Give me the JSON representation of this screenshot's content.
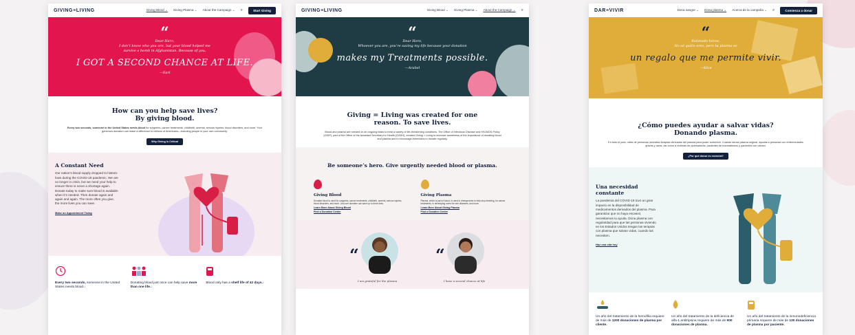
{
  "colors": {
    "navy": "#14213d",
    "crimson": "#e3154f",
    "teal": "#1f3b44",
    "gold": "#e0ad3a",
    "pink_bg": "#f7edf0"
  },
  "panel1": {
    "logo": "GIVING≡LIVING",
    "nav": {
      "link1": "Giving Blood ⌄",
      "link2": "Giving Plasma ⌄",
      "link3": "About the Campaign ⌄",
      "search_icon": "search-icon",
      "cta": "Start Giving"
    },
    "hero": {
      "quote_mark": "“",
      "line1": "Dear Hero,",
      "line2": "I don’t know who you are, but your blood helped me",
      "line3": "survive a bomb in Afghanistan. Because of you,",
      "big": "I GOT A SECOND CHANCE AT LIFE.",
      "sig": "—Earl"
    },
    "help": {
      "title1": "How can you help save lives?",
      "title2": "By giving blood.",
      "body_bold": "Every two seconds, someone in the United States needs blood",
      "body": " for surgeries, cancer treatments, childbirth, anemia, serious injuries, blood disorders, and more. Your generous donation can make a difference to millions of Americans—including people in your own community.",
      "button": "Why Giving is Critical"
    },
    "need": {
      "title": "A Constant Need",
      "body": "Our nation’s blood supply dropped to historic lows during the COVID-19 pandemic. We are no longer in crisis, but we need your help to ensure there is never a shortage again. Donate today to make sure blood is available when it’s needed. Then donate again and again and again. The more often you give, the more lives you can save.",
      "link": "Make an Appointment Today"
    },
    "stats": [
      {
        "icon": "clock-icon",
        "bold": "Every two seconds,",
        "text": " someone in the United States needs blood.↓"
      },
      {
        "icon": "people-icon",
        "text": "Donating blood just once can help save ",
        "bold": "more than one life.",
        "tail": "↓"
      },
      {
        "icon": "blood-bag-icon",
        "text": "Blood only has a ",
        "bold": "shelf life of 42 days.",
        "tail": "↓"
      }
    ]
  },
  "panel2": {
    "logo": "GIVING≡LIVING",
    "nav": {
      "link1": "Giving Blood ⌄",
      "link2": "Giving Plasma ⌄",
      "link3": "About the Campaign ⌄",
      "search_icon": "search-icon"
    },
    "hero": {
      "quote_mark": "“",
      "line1": "Dear Hero,",
      "line2": "Whoever you are, you’re saving my life because your donation",
      "big": "makes my Treatments possible.",
      "sig": "—Arabel"
    },
    "about": {
      "title1": "Giving = Living was created for one",
      "title2": "reason. To save lives.",
      "body": "Blood and plasma are needed on an ongoing basis to treat a variety of life-threatening conditions. The Office of Infectious Disease and HIV/AIDS Policy (OIDP), part of the Office of the Assistant Secretary for Health (OASH), created Giving = Living to increase awareness of the importance of donating blood and plasma and to encourage Americans to donate regularly."
    },
    "hero_sec": {
      "title": "Be someone’s hero. Give urgently needed blood or plasma."
    },
    "blood": {
      "title": "Giving Blood",
      "body": "Donated blood is used for surgeries, cancer treatments, childbirth, anemia, serious injuries, blood disorders, and more. Just one donation can save up to three lives.",
      "link1": "Learn More About Giving Blood",
      "link2": "Find a Donation Center"
    },
    "plasma": {
      "title": "Giving Plasma",
      "body": "Plasma, which is part of blood, is used in emergencies to help stop bleeding, for cancer treatments, in developing cures for rare diseases, and more.",
      "link1": "Learn More About Giving Plasma",
      "link2": "Find a Donation Center"
    },
    "testimonials": {
      "q1": "I am grateful for the plasma",
      "q2": "I have a second chance at life"
    }
  },
  "panel3": {
    "logo": "DAR≡VIVIR",
    "nav": {
      "link1": "Dona sangre ⌄",
      "link2": "Dona plasma ⌄",
      "link3": "Acerca de la campaña ⌄",
      "search_icon": "search-icon",
      "cta": "Comienza a donar"
    },
    "hero": {
      "quote_mark": "“",
      "line1": "Estimado héroe,",
      "line2": "No sé quién eres, pero tu plasma es",
      "big": "un regalo que me permite vivir.",
      "sig": "—Alice"
    },
    "help": {
      "title1": "¿Cómo puedes ayudar a salvar vidas?",
      "title2": "Donando plasma.",
      "body": "En todo el país, miles de personas necesitan terapias derivadas del plasma para poder sobrevivir. Cuando donas plasma original, ayudas a personas con enfermedades graves y raras, así como a víctimas de quemaduras, pacientes de traumatismos y pacientes con cáncer.",
      "button": "¿Por qué donar es esencial?"
    },
    "need": {
      "title": "Una necesidad constante",
      "body": "La pandemia del COVID-19 tuvo un gran impacto en la disponibilidad de medicamentos derivados del plasma. Para garantizar que no haya escasez, necesitamos tu ayuda. Dona plasma con regularidad para que las personas viviendo en los Estados Unidos tengan las terapias con plasma que salvan vidas, cuando las necesiten.",
      "link": "Haz una cita hoy"
    },
    "stats": [
      {
        "icon": "hand-drop-icon",
        "text": "Un año del tratamiento de la hemofilia requiere de más de ",
        "bold": "1200 donaciones de plasma por cliente."
      },
      {
        "icon": "plasma-drop-icon",
        "text": "Un año del tratamiento de la deficiencia de alfa-1 antitripsina requiere de más de ",
        "bold": "900 donaciones de plasma."
      },
      {
        "icon": "plasma-bag-icon",
        "text": "Un año del tratamiento de la inmunodeficiencia primaria requiere de más de ",
        "bold": "130 donaciones de plasma por paciente."
      }
    ]
  }
}
